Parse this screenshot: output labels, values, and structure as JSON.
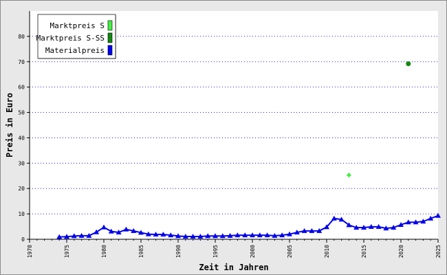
{
  "chart_data": {
    "type": "line",
    "xlabel": "Zeit in Jahren",
    "ylabel": "Preis in Euro",
    "xlim": [
      1970,
      2025
    ],
    "ylim": [
      0,
      90
    ],
    "x_ticks": [
      1970,
      1975,
      1980,
      1985,
      1990,
      1995,
      2000,
      2005,
      2010,
      2015,
      2020,
      2025
    ],
    "y_ticks": [
      0,
      10,
      20,
      30,
      40,
      50,
      60,
      70,
      80
    ],
    "grid": "horizontal dotted",
    "legend_position": "top-left",
    "series": [
      {
        "name": "Marktpreis S",
        "color": "#44ee44",
        "style": "marker-only",
        "marker": "diamond",
        "points": [
          [
            2013,
            25.3
          ]
        ]
      },
      {
        "name": "Marktpreis S-SS",
        "color": "#118811",
        "style": "marker-only",
        "marker": "circle",
        "points": [
          [
            2021,
            69.2
          ]
        ]
      },
      {
        "name": "Materialpreis",
        "color": "#0000ee",
        "style": "line",
        "marker": "triangle",
        "points": [
          [
            1974,
            0.9
          ],
          [
            1975,
            1.0
          ],
          [
            1976,
            1.3
          ],
          [
            1977,
            1.4
          ],
          [
            1978,
            1.4
          ],
          [
            1979,
            2.8
          ],
          [
            1980,
            4.7
          ],
          [
            1981,
            3.1
          ],
          [
            1982,
            2.7
          ],
          [
            1983,
            3.9
          ],
          [
            1984,
            3.3
          ],
          [
            1985,
            2.6
          ],
          [
            1986,
            2.0
          ],
          [
            1987,
            1.9
          ],
          [
            1988,
            1.9
          ],
          [
            1989,
            1.6
          ],
          [
            1990,
            1.3
          ],
          [
            1991,
            1.1
          ],
          [
            1992,
            1.1
          ],
          [
            1993,
            1.1
          ],
          [
            1994,
            1.3
          ],
          [
            1995,
            1.3
          ],
          [
            1996,
            1.3
          ],
          [
            1997,
            1.4
          ],
          [
            1998,
            1.6
          ],
          [
            1999,
            1.6
          ],
          [
            2000,
            1.6
          ],
          [
            2001,
            1.6
          ],
          [
            2002,
            1.6
          ],
          [
            2003,
            1.4
          ],
          [
            2004,
            1.6
          ],
          [
            2005,
            2.0
          ],
          [
            2006,
            2.7
          ],
          [
            2007,
            3.3
          ],
          [
            2008,
            3.3
          ],
          [
            2009,
            3.3
          ],
          [
            2010,
            4.8
          ],
          [
            2011,
            8.2
          ],
          [
            2012,
            7.8
          ],
          [
            2013,
            5.6
          ],
          [
            2014,
            4.6
          ],
          [
            2015,
            4.6
          ],
          [
            2016,
            4.9
          ],
          [
            2017,
            4.9
          ],
          [
            2018,
            4.3
          ],
          [
            2019,
            4.6
          ],
          [
            2020,
            5.7
          ],
          [
            2021,
            6.7
          ],
          [
            2022,
            6.7
          ],
          [
            2023,
            7.0
          ],
          [
            2024,
            8.2
          ],
          [
            2025,
            9.3
          ]
        ]
      }
    ]
  }
}
